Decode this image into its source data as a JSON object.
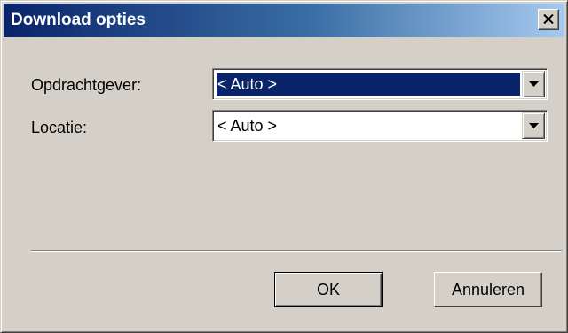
{
  "window": {
    "title": "Download opties",
    "close_label": "close"
  },
  "form": {
    "opdrachtgever": {
      "label": "Opdrachtgever:",
      "value": "< Auto >"
    },
    "locatie": {
      "label": "Locatie:",
      "value": "< Auto >"
    }
  },
  "buttons": {
    "ok_label": "OK",
    "cancel_label": "Annuleren"
  },
  "icons": {
    "close": "close-icon",
    "dropdown": "chevron-down-icon"
  },
  "colors": {
    "title_gradient_start": "#0a246a",
    "title_gradient_end": "#a6caf0",
    "selection": "#0a246a",
    "face": "#d4d0c8"
  }
}
